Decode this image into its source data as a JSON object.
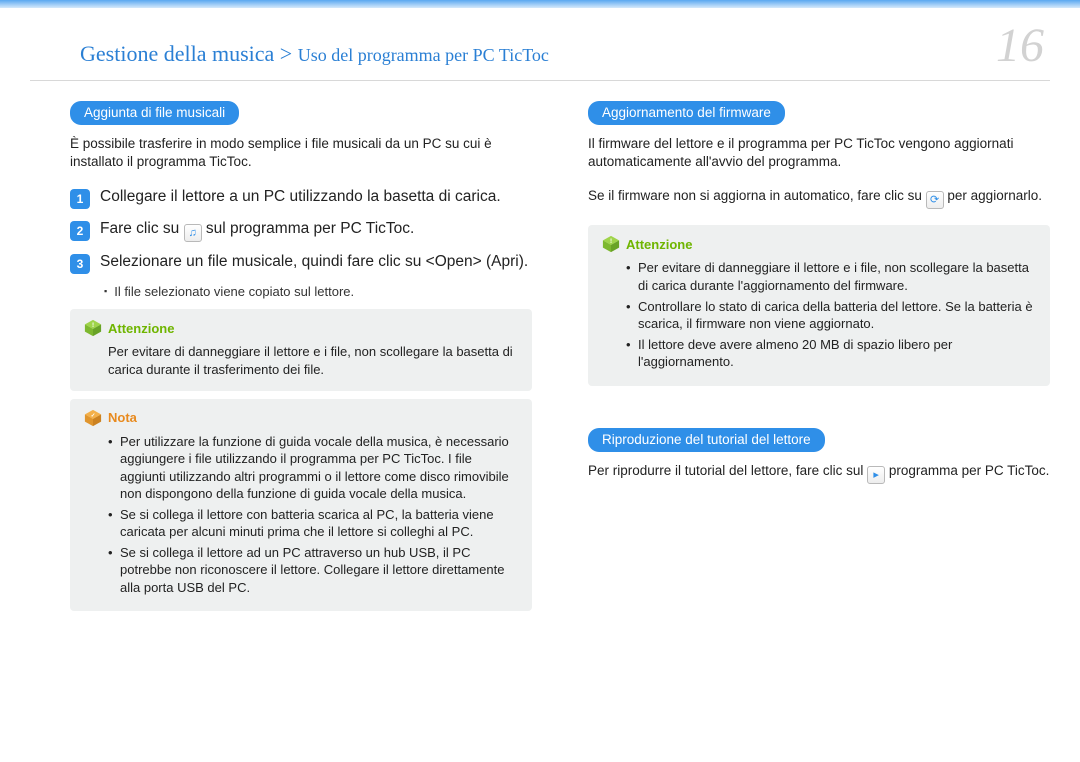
{
  "header": {
    "breadcrumb_main": "Gestione della musica",
    "breadcrumb_sep": " > ",
    "breadcrumb_sub": "Uso del programma per PC TicToc",
    "page_number": "16"
  },
  "left": {
    "section1": {
      "title": "Aggiunta di file musicali",
      "intro": "È possibile trasferire in modo semplice i file musicali da un PC su cui è installato il programma TicToc.",
      "steps": {
        "s1": "Collegare il lettore a un PC utilizzando la basetta di carica.",
        "s2_a": "Fare clic su ",
        "s2_b": " sul programma per PC TicToc.",
        "s3": "Selezionare un file musicale, quindi fare clic su <Open> (Apri).",
        "s3_sub": "Il file selezionato viene copiato sul lettore."
      },
      "attention": {
        "label": "Attenzione",
        "body": "Per evitare di danneggiare il lettore e i file, non scollegare la basetta di carica durante il trasferimento dei file."
      },
      "note": {
        "label": "Nota",
        "items": {
          "i1": "Per utilizzare la funzione di guida vocale della musica, è necessario aggiungere i file utilizzando il programma per PC TicToc. I file aggiunti utilizzando altri programmi o il lettore come disco rimovibile non dispongono della funzione di guida vocale della musica.",
          "i2": "Se si collega il lettore con batteria scarica al PC, la batteria viene caricata per alcuni minuti prima che il lettore si colleghi al PC.",
          "i3": "Se si collega il lettore ad un PC attraverso un hub USB, il PC potrebbe non riconoscere il lettore. Collegare il lettore direttamente alla porta USB del PC."
        }
      }
    }
  },
  "right": {
    "section1": {
      "title": "Aggiornamento del firmware",
      "p1": "Il firmware del lettore e il programma per PC TicToc vengono aggiornati automaticamente all'avvio del programma.",
      "p2_a": "Se il firmware non si aggiorna in automatico, fare clic su ",
      "p2_b": " per aggiornarlo.",
      "attention": {
        "label": "Attenzione",
        "items": {
          "i1": "Per evitare di danneggiare il lettore e i file, non scollegare la basetta di carica durante l'aggiornamento del firmware.",
          "i2": "Controllare lo stato di carica della batteria del lettore. Se la batteria è scarica, il firmware non viene aggiornato.",
          "i3": "Il lettore deve avere almeno 20 MB di spazio libero per l'aggiornamento."
        }
      }
    },
    "section2": {
      "title": "Riproduzione del tutorial del lettore",
      "p1_a": "Per riprodurre il tutorial del lettore, fare clic sul ",
      "p1_b": " programma per PC TicToc."
    }
  }
}
